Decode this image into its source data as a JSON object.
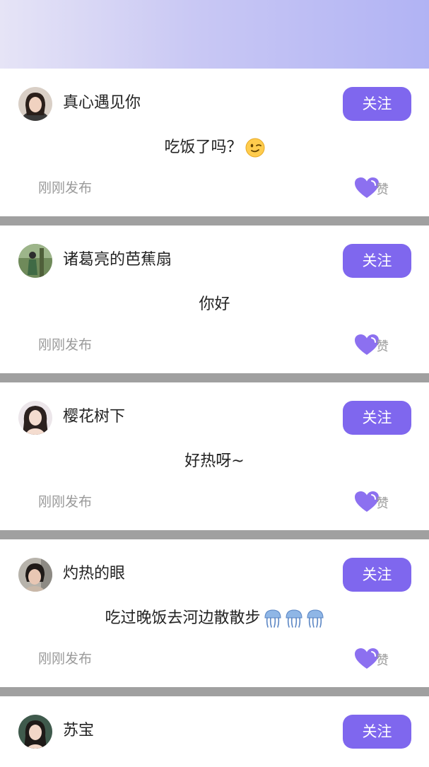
{
  "colors": {
    "accent": "#7f67ee",
    "heart": "#8c70f0",
    "separator": "#a0a0a0",
    "banner_start": "#e6e4f6",
    "banner_end": "#b1b3f4"
  },
  "posts": [
    {
      "username": "真心遇见你",
      "follow_label": "关注",
      "content": "吃饭了吗？",
      "emoji": [
        "winking-face-emoji"
      ],
      "time": "刚刚发布",
      "like_label": "赞"
    },
    {
      "username": "诸葛亮的芭蕉扇",
      "follow_label": "关注",
      "content": "你好",
      "emoji": [],
      "time": "刚刚发布",
      "like_label": "赞"
    },
    {
      "username": "樱花树下",
      "follow_label": "关注",
      "content": "好热呀~",
      "emoji": [],
      "time": "刚刚发布",
      "like_label": "赞"
    },
    {
      "username": "灼热的眼",
      "follow_label": "关注",
      "content": "吃过晚饭去河边散散步",
      "emoji": [
        "jellyfish-emoji",
        "jellyfish-emoji",
        "jellyfish-emoji"
      ],
      "time": "刚刚发布",
      "like_label": "赞"
    },
    {
      "username": "苏宝",
      "follow_label": "关注"
    }
  ]
}
